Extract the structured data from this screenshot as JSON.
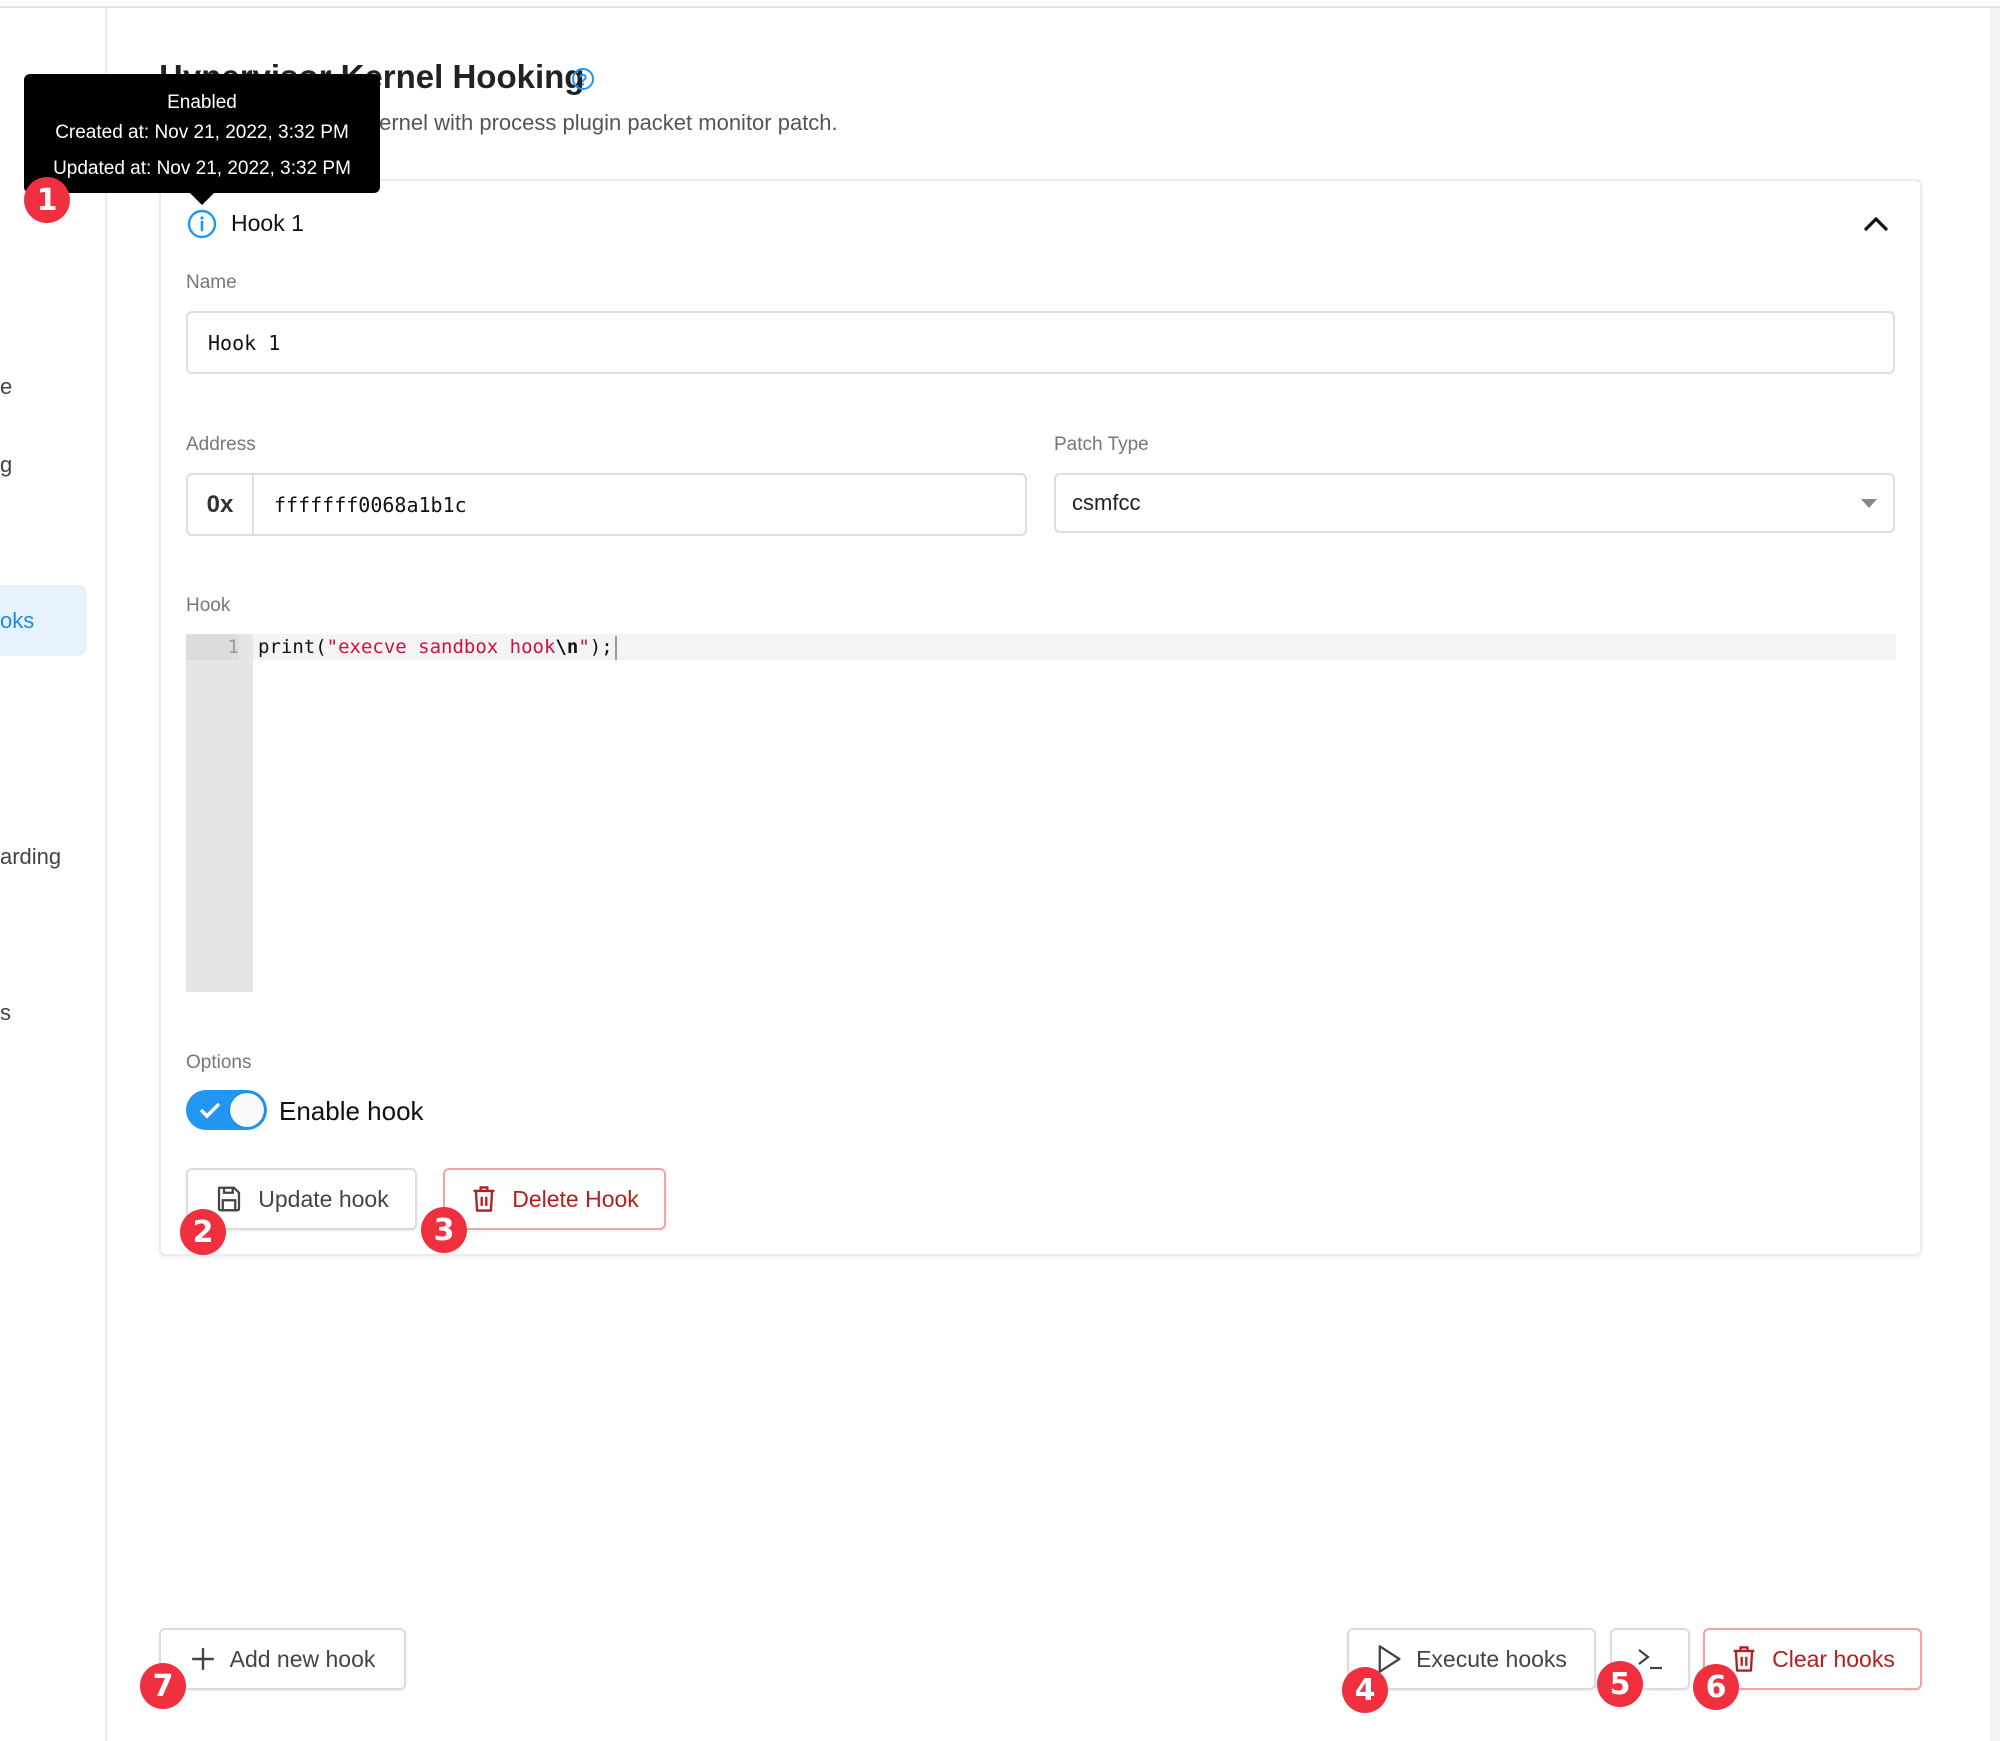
{
  "sidebar": {
    "items": [
      {
        "label": "e",
        "active": false
      },
      {
        "label": "g",
        "active": false
      },
      {
        "label": "oks",
        "active": true
      },
      {
        "label": "arding",
        "active": false
      },
      {
        "label": "s",
        "active": false
      }
    ]
  },
  "page": {
    "title": "Hypervisor Kernel Hooking",
    "help_icon": "question-circle-icon",
    "subtitle": "Hook the Hypervisor Kernel with process plugin packet monitor patch."
  },
  "hook": {
    "title": "Hook 1",
    "expanded": true,
    "name_label": "Name",
    "name_value": "Hook 1",
    "address_label": "Address",
    "address_prefix": "0x",
    "address_value": "fffffff0068a1b1c",
    "patch_type_label": "Patch Type",
    "patch_type_value": "csmfcc",
    "code_label": "Hook",
    "code_lines": [
      {
        "number": "1",
        "tokens": [
          {
            "text": "print(",
            "kind": "plain"
          },
          {
            "text": "\"execve sandbox hook",
            "kind": "str"
          },
          {
            "text": "\\n",
            "kind": "esc"
          },
          {
            "text": "\"",
            "kind": "str"
          },
          {
            "text": ");",
            "kind": "plain"
          }
        ]
      }
    ],
    "options_label": "Options",
    "enable_label": "Enable hook",
    "enabled": true,
    "update_label": "Update hook",
    "delete_label": "Delete Hook"
  },
  "tooltip": {
    "status": "Enabled",
    "created": "Created at: Nov 21, 2022, 3:32 PM",
    "updated": "Updated at: Nov 21, 2022, 3:32 PM"
  },
  "footer": {
    "add_label": "Add new hook",
    "execute_label": "Execute hooks",
    "terminal_icon": "terminal-icon",
    "clear_label": "Clear hooks"
  },
  "badges": [
    "1",
    "2",
    "3",
    "4",
    "5",
    "6",
    "7"
  ],
  "colors": {
    "accent": "#2196f3",
    "danger": "#b71c1c",
    "badge": "#f0303f",
    "string": "#d1103d"
  }
}
